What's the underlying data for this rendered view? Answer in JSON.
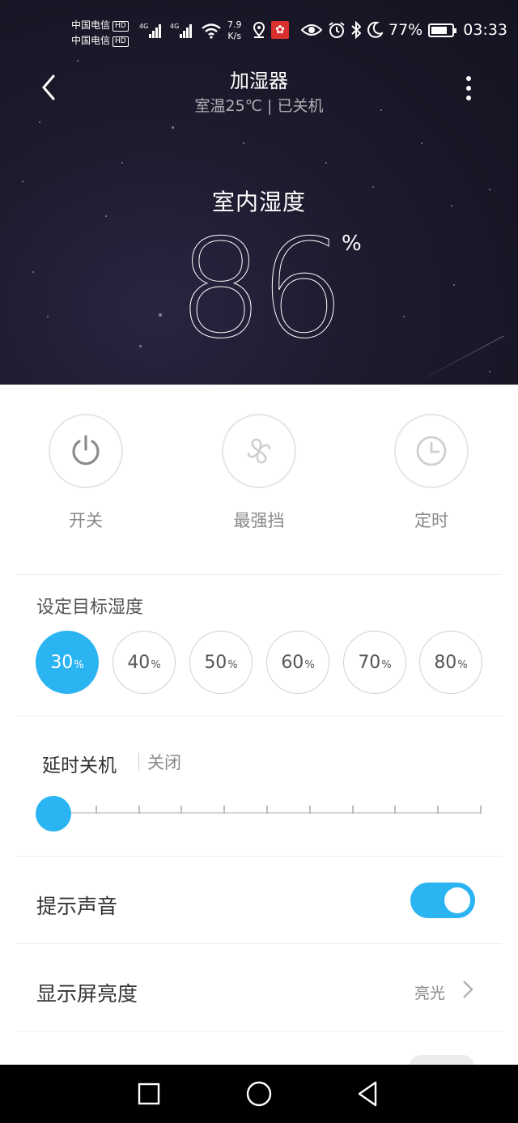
{
  "status_bar": {
    "carrier_1": "中国电信",
    "carrier_2": "中国电信",
    "hd_badge": "HD",
    "network_type": "4G",
    "speed_value": "7.9",
    "speed_unit": "K/s",
    "battery": "77%",
    "battery_level": 0.77,
    "time": "03:33",
    "icons": [
      "location-icon",
      "app-notification-icon",
      "eye-icon",
      "alarm-icon",
      "bluetooth-icon",
      "moon-icon",
      "battery-icon"
    ]
  },
  "header": {
    "title": "加湿器",
    "subtitle": "室温25℃ | 已关机",
    "back_icon": "back-arrow-icon",
    "more_icon": "more-vertical-icon"
  },
  "humidity": {
    "label": "室内湿度",
    "value": "86",
    "unit": "%"
  },
  "actions": [
    {
      "label": "开关",
      "icon": "power-icon"
    },
    {
      "label": "最强挡",
      "icon": "fan-icon"
    },
    {
      "label": "定时",
      "icon": "clock-icon"
    }
  ],
  "target_humidity": {
    "title": "设定目标湿度",
    "unit": "%",
    "options": [
      "30",
      "40",
      "50",
      "60",
      "70",
      "80"
    ],
    "selected": "30"
  },
  "delay_off": {
    "title": "延时关机",
    "value": "关闭",
    "slider_steps": 10,
    "slider_position": 0
  },
  "sound": {
    "label": "提示声音",
    "enabled": true
  },
  "brightness": {
    "label": "显示屏亮度",
    "value": "亮光"
  },
  "colors": {
    "accent": "#2ab4f2",
    "hero_bg": "#1c1a2c"
  },
  "nav": [
    "recent-apps-icon",
    "home-icon",
    "back-icon"
  ]
}
